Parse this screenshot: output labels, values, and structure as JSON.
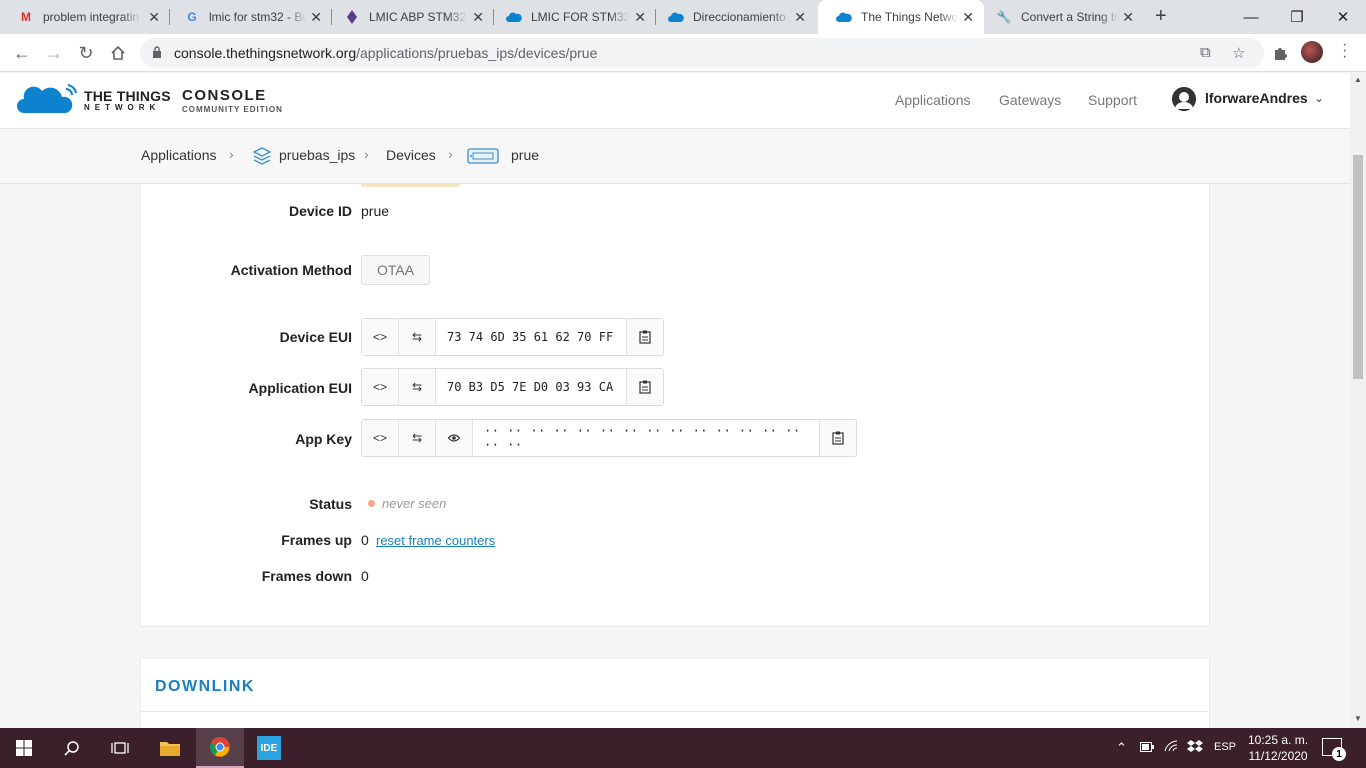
{
  "browser": {
    "tabs": [
      {
        "title": "problem integratin",
        "icon": "gmail-icon"
      },
      {
        "title": "lmic for stm32 - Bu",
        "icon": "google-icon"
      },
      {
        "title": "LMIC ABP STM32C",
        "icon": "stackoverflow-icon"
      },
      {
        "title": "LMIC FOR STM32C",
        "icon": "ttn-cloud-icon"
      },
      {
        "title": "Direccionamiento",
        "icon": "ttn-cloud-icon"
      },
      {
        "title": "The Things Netwo",
        "icon": "ttn-cloud-icon"
      },
      {
        "title": "Convert a String to",
        "icon": "wrench-icon"
      }
    ],
    "url_host": "console.thethingsnetwork.org",
    "url_path": "/applications/pruebas_ips/devices/prue"
  },
  "header": {
    "logo_line1": "THE THINGS",
    "logo_line2": "NETWORK",
    "console": "CONSOLE",
    "edition": "COMMUNITY EDITION",
    "nav": [
      "Applications",
      "Gateways",
      "Support"
    ],
    "username": "lforwareAndres"
  },
  "breadcrumb": {
    "applications": "Applications",
    "app": "pruebas_ips",
    "devices": "Devices",
    "device": "prue"
  },
  "device": {
    "device_id_label": "Device ID",
    "device_id": "prue",
    "activation_label": "Activation Method",
    "activation": "OTAA",
    "dev_eui_label": "Device EUI",
    "dev_eui": "73 74 6D 35 61 62 70 FF",
    "app_eui_label": "Application EUI",
    "app_eui": "70 B3 D5 7E D0 03 93 CA",
    "app_key_label": "App Key",
    "app_key": "·· ·· ·· ·· ·· ·· ·· ·· ·· ·· ·· ·· ·· ·· ·· ··",
    "status_label": "Status",
    "status": "never seen",
    "frames_up_label": "Frames up",
    "frames_up": "0",
    "reset_link": "reset frame counters",
    "frames_down_label": "Frames down",
    "frames_down": "0"
  },
  "downlink": {
    "heading": "DOWNLINK"
  },
  "taskbar": {
    "ide_label": "IDE",
    "lang": "ESP",
    "time": "10:25 a. m.",
    "date": "11/12/2020",
    "notif_count": "1"
  }
}
